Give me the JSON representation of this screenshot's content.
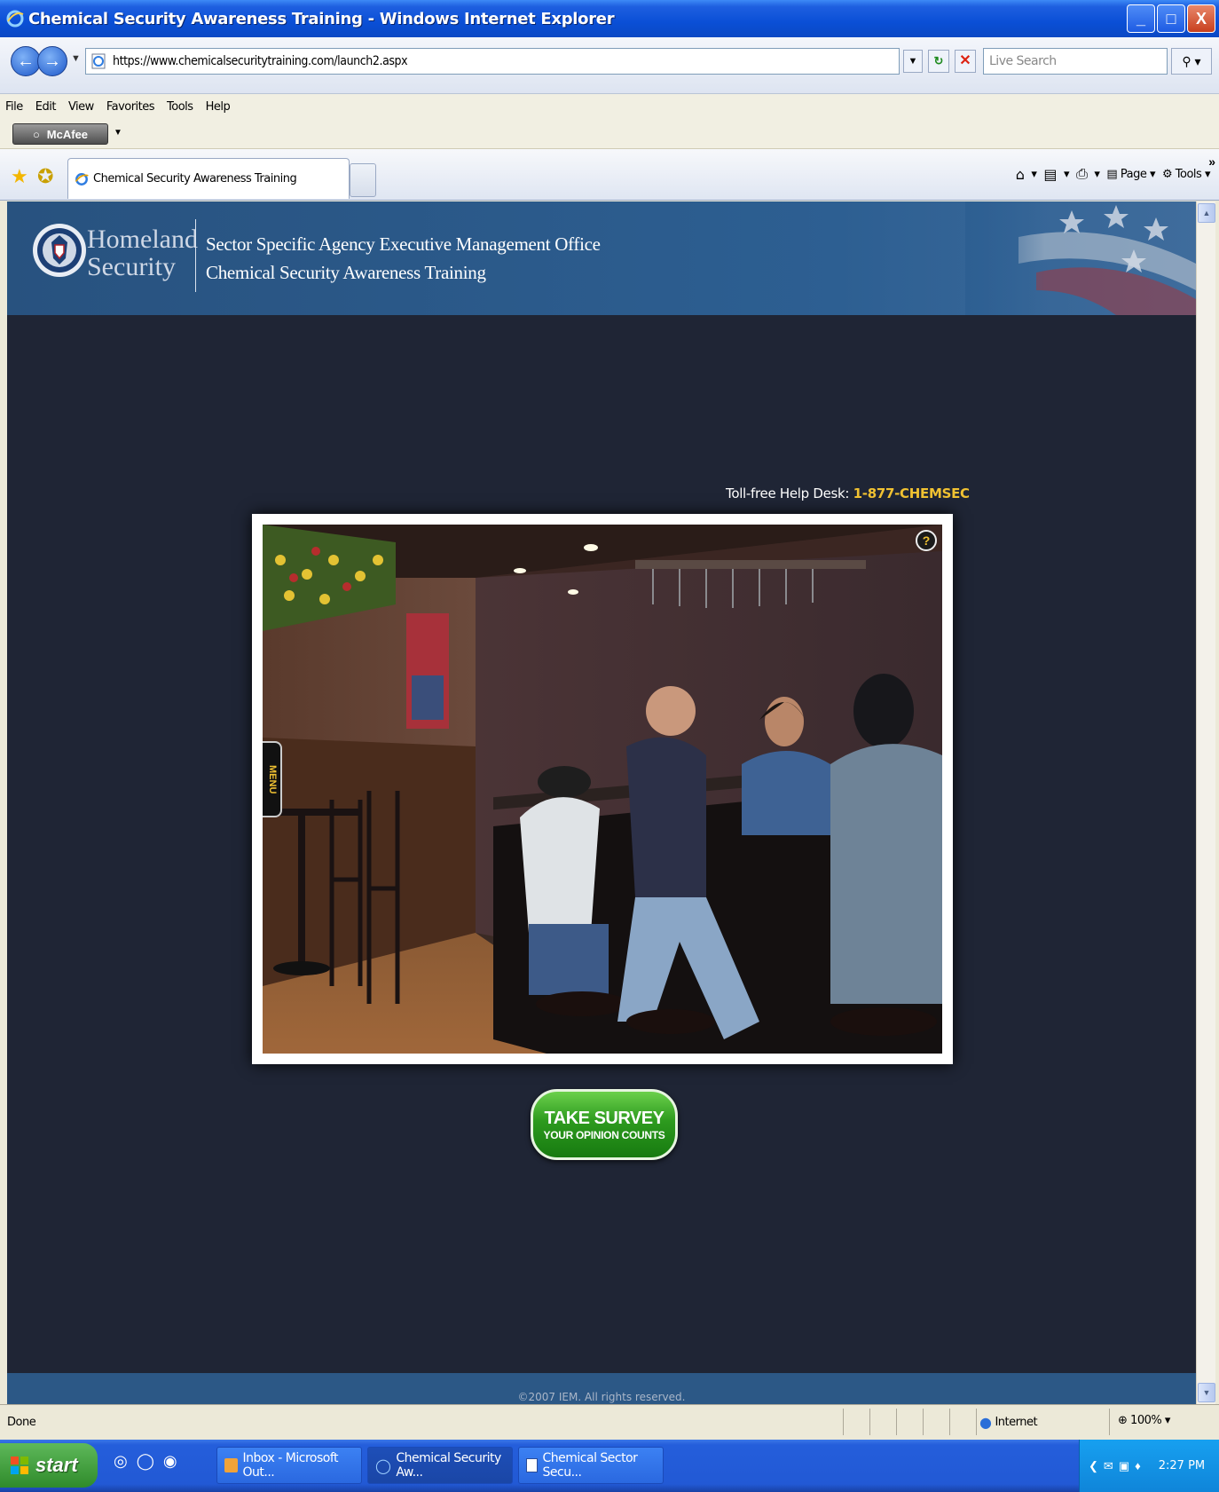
{
  "window": {
    "title": "Chemical Security Awareness Training - Windows Internet Explorer",
    "controls": {
      "minimize": "_",
      "maximize": "□",
      "close": "X"
    }
  },
  "address": {
    "url": "https://www.chemicalsecuritytraining.com/launch2.aspx",
    "search_placeholder": "Live Search"
  },
  "menu": [
    "File",
    "Edit",
    "View",
    "Favorites",
    "Tools",
    "Help"
  ],
  "toolbar": {
    "mcafee_label": "McAfee"
  },
  "tabs": {
    "active_label": "Chemical Security Awareness Training",
    "commands": {
      "page": "Page",
      "tools": "Tools"
    }
  },
  "site": {
    "brand_line1": "Homeland",
    "brand_line2": "Security",
    "office": "Sector Specific Agency Executive Management Office",
    "training": "Chemical Security Awareness Training",
    "helpdesk_label": "Toll-free Help Desk:",
    "helpdesk_phone": "1-877-CHEMSEC",
    "help_icon_label": "?",
    "menu_tab_label": "MENU",
    "survey_line1": "TAKE SURVEY",
    "survey_line2": "YOUR OPINION COUNTS",
    "footer": "©2007 IEM. All rights reserved."
  },
  "status": {
    "text": "Done",
    "zone": "Internet",
    "zoom": "100%"
  },
  "taskbar": {
    "start_label": "start",
    "tasks": [
      {
        "label": "Inbox - Microsoft Out..."
      },
      {
        "label": "Chemical Security Aw..."
      },
      {
        "label": "Chemical Sector Secu..."
      }
    ],
    "clock": "2:27 PM"
  },
  "colors": {
    "content_bg": "#1f2535",
    "header_bg": "#2d5f92",
    "accent_phone": "#f1c232",
    "survey_green": "#2d9a1e"
  }
}
